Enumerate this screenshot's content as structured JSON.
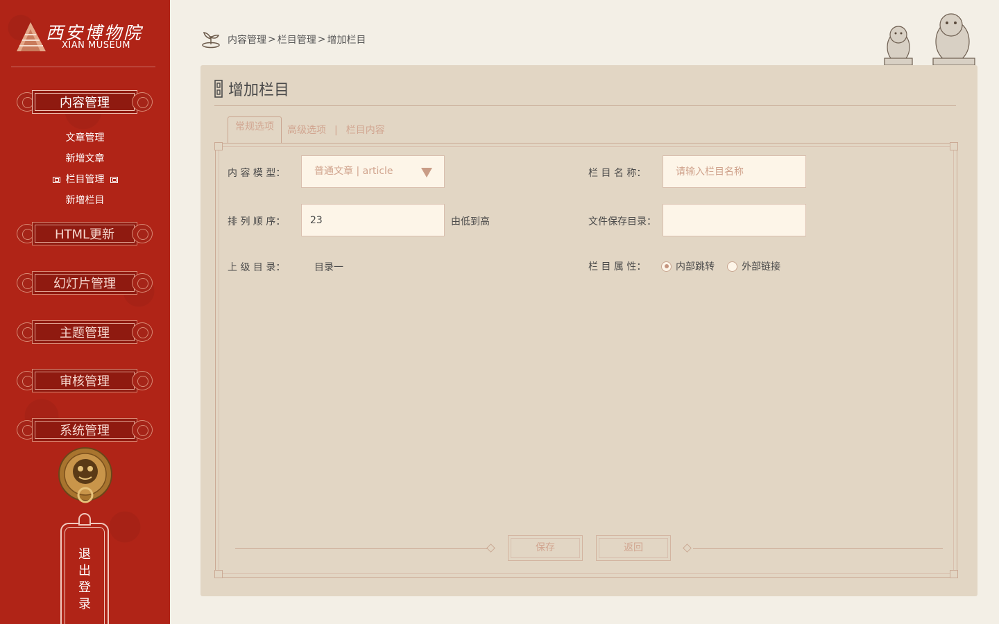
{
  "sidebar": {
    "logo": {
      "cn": "西安博物院",
      "en": "XIAN MUSEUM"
    },
    "menu": [
      {
        "label": "内容管理",
        "active": true
      },
      {
        "label": "HTML更新",
        "active": false
      },
      {
        "label": "幻灯片管理",
        "active": false
      },
      {
        "label": "主题管理",
        "active": false
      },
      {
        "label": "审核管理",
        "active": false
      },
      {
        "label": "系统管理",
        "active": false
      }
    ],
    "submenu": [
      {
        "label": "文章管理",
        "active": false
      },
      {
        "label": "新增文章",
        "active": false
      },
      {
        "label": "栏目管理",
        "active": true
      },
      {
        "label": "新增栏目",
        "active": false
      }
    ],
    "logout": [
      "退",
      "出",
      "登",
      "录"
    ]
  },
  "header": {
    "breadcrumb": [
      "内容管理",
      "栏目管理",
      "增加栏目"
    ],
    "separator": ">"
  },
  "panel": {
    "title": "增加栏目",
    "tabs": [
      {
        "label": "常规选项",
        "active": true
      },
      {
        "label": "高级选项",
        "active": false
      },
      {
        "label": "栏目内容",
        "active": false
      }
    ],
    "tab_separator": "|",
    "form": {
      "content_model": {
        "label": "内 容 模 型：",
        "value": "普通文章 | article"
      },
      "column_name": {
        "label": "栏 目 名 称：",
        "placeholder": "请输入栏目名称"
      },
      "sort_order": {
        "label": "排 列 顺 序：",
        "value": "23",
        "hint": "由低到高"
      },
      "save_dir": {
        "label": "文件保存目录：",
        "value": ""
      },
      "parent_dir": {
        "label": "上 级 目 录：",
        "value": "目录一"
      },
      "column_attr": {
        "label": "栏 目 属 性：",
        "options": [
          {
            "label": "内部跳转",
            "checked": true
          },
          {
            "label": "外部链接",
            "checked": false
          }
        ]
      }
    },
    "buttons": {
      "save": "保存",
      "back": "返回"
    }
  },
  "colors": {
    "sidebar_red": "#b02417",
    "panel_bg": "#e2d6c4",
    "page_bg": "#f3efe6",
    "accent_tan": "#d1a590",
    "input_bg": "#fdf5e8"
  },
  "icons": [
    "pagoda-logo-icon",
    "sprout-icon",
    "meander-title-icon",
    "lion-statues-image",
    "door-knocker-image",
    "chevron-down-icon"
  ]
}
